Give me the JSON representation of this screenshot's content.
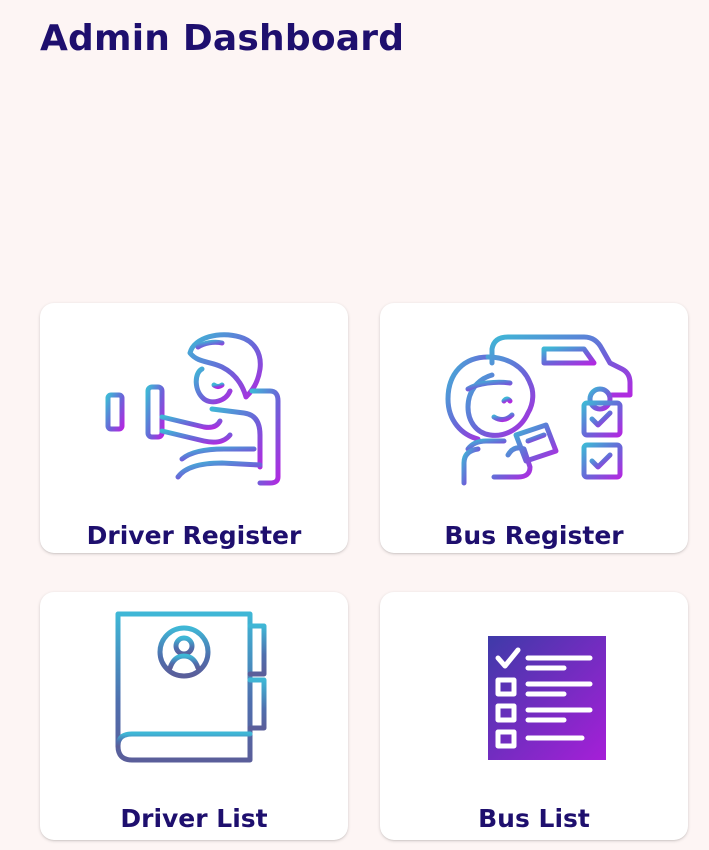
{
  "header": {
    "title": "Admin Dashboard"
  },
  "colors": {
    "background": "#fdf5f4",
    "title_text": "#1e0f6e",
    "card_background": "#ffffff",
    "icon_gradient_start": "#3fb7d6",
    "icon_gradient_mid": "#6b63d8",
    "icon_gradient_end": "#b12ae0"
  },
  "menu": {
    "items": [
      {
        "label": "Driver Register",
        "icon": "driver-steering-icon"
      },
      {
        "label": "Bus Register",
        "icon": "vehicle-checklist-icon"
      },
      {
        "label": "Driver List",
        "icon": "profile-book-icon"
      },
      {
        "label": "Bus List",
        "icon": "checklist-document-icon"
      }
    ]
  }
}
